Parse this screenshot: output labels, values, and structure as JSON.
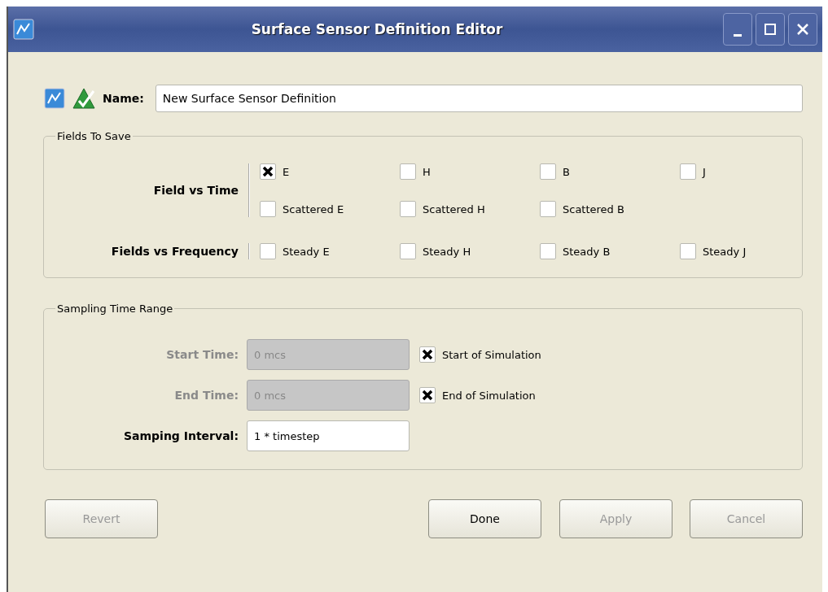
{
  "window": {
    "title": "Surface Sensor Definition Editor"
  },
  "name_field": {
    "label": "Name:",
    "value": "New Surface Sensor Definition"
  },
  "fields_to_save": {
    "title": "Fields To Save",
    "groups": [
      {
        "label": "Field vs Time",
        "rows": [
          [
            {
              "label": "E",
              "checked": true
            },
            {
              "label": "H",
              "checked": false
            },
            {
              "label": "B",
              "checked": false
            },
            {
              "label": "J",
              "checked": false
            }
          ],
          [
            {
              "label": "Scattered E",
              "checked": false
            },
            {
              "label": "Scattered H",
              "checked": false
            },
            {
              "label": "Scattered B",
              "checked": false
            }
          ]
        ]
      },
      {
        "label": "Fields vs Frequency",
        "rows": [
          [
            {
              "label": "Steady E",
              "checked": false
            },
            {
              "label": "Steady H",
              "checked": false
            },
            {
              "label": "Steady B",
              "checked": false
            },
            {
              "label": "Steady J",
              "checked": false
            }
          ]
        ]
      }
    ]
  },
  "sampling_time_range": {
    "title": "Sampling Time Range",
    "rows": [
      {
        "label": "Start Time:",
        "value": "0 mcs",
        "disabled": true,
        "option": {
          "label": "Start of Simulation",
          "checked": true
        }
      },
      {
        "label": "End Time:",
        "value": "0 mcs",
        "disabled": true,
        "option": {
          "label": "End of Simulation",
          "checked": true
        }
      },
      {
        "label": "Samping Interval:",
        "value": "1 * timestep",
        "disabled": false
      }
    ]
  },
  "buttons": [
    {
      "label": "Revert",
      "disabled": true
    },
    {
      "label": "Done",
      "disabled": false
    },
    {
      "label": "Apply",
      "disabled": true
    },
    {
      "label": "Cancel",
      "disabled": true
    }
  ]
}
